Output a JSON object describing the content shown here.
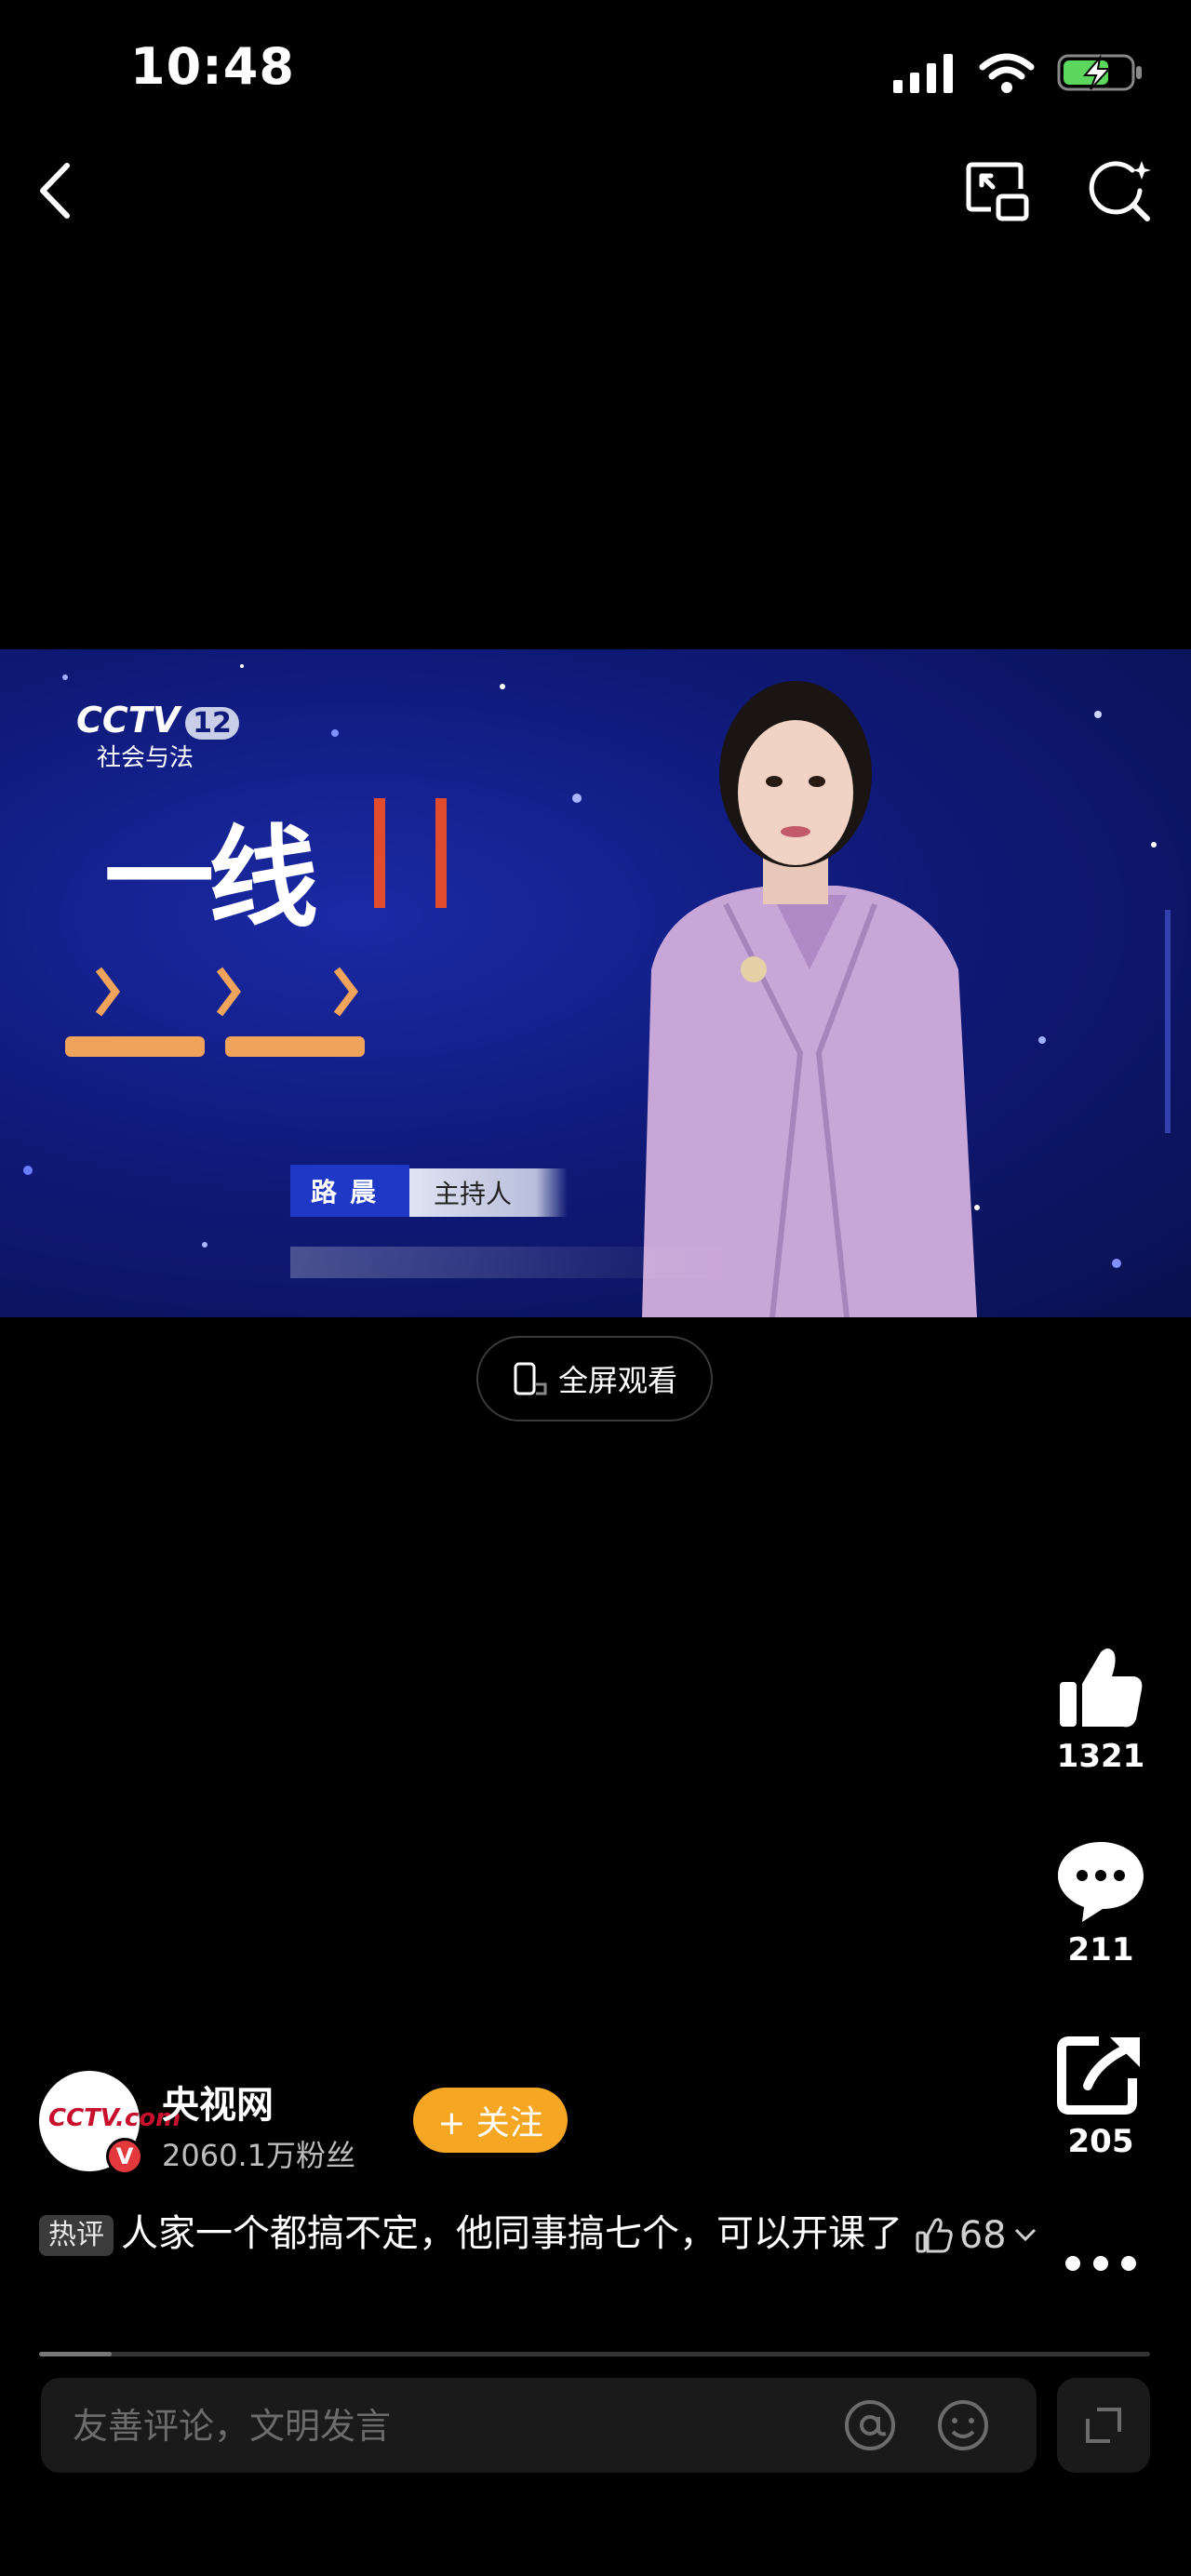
{
  "status_bar": {
    "time": "10:48"
  },
  "video": {
    "channel_logo": "CCTV",
    "channel_number": "12",
    "channel_name": "社会与法",
    "program_title": "一线",
    "presenter_name": "路晨",
    "presenter_role": "主持人"
  },
  "fullscreen_label": "全屏观看",
  "actions": {
    "like_count": "1321",
    "comment_count": "211",
    "share_count": "205"
  },
  "author": {
    "avatar_text": "CCTV.com",
    "name": "央视网",
    "fans": "2060.1万粉丝",
    "follow_label": "+ 关注"
  },
  "hot_comment": {
    "tag": "热评",
    "text": "人家一个都搞不定，他同事搞七个，可以开课了",
    "likes": "68"
  },
  "progress": {
    "fraction": 0.065
  },
  "comment_input": {
    "placeholder": "友善评论，文明发言"
  },
  "colors": {
    "accent_follow": "#f5a623",
    "video_bg": "#0f1a7a"
  }
}
